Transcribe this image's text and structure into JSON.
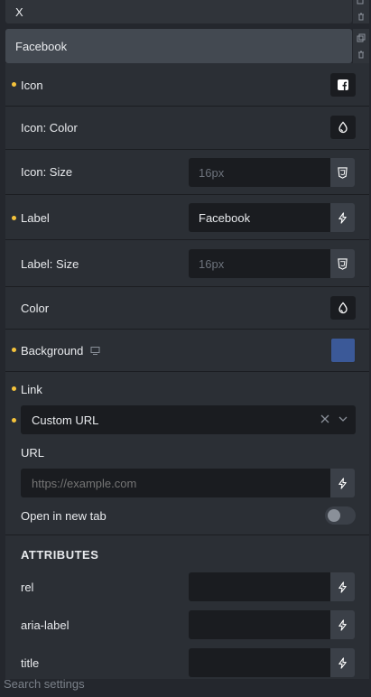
{
  "repeater": {
    "items": [
      {
        "label": "X"
      },
      {
        "label": "Facebook"
      }
    ]
  },
  "fields": {
    "icon": {
      "label": "Icon",
      "icon": "facebook-square-icon"
    },
    "icon_color": {
      "label": "Icon: Color",
      "icon": "color-drop-icon"
    },
    "icon_size": {
      "label": "Icon: Size",
      "placeholder": "16px",
      "suffix_icon": "css-shield-icon"
    },
    "label": {
      "label": "Label",
      "value": "Facebook",
      "suffix_icon": "bolt-icon"
    },
    "label_size": {
      "label": "Label: Size",
      "placeholder": "16px",
      "suffix_icon": "css-shield-icon"
    },
    "color": {
      "label": "Color",
      "icon": "color-drop-icon"
    },
    "background": {
      "label": "Background",
      "icon": "monitor-icon",
      "swatch_color": "#3b5998"
    },
    "link": {
      "label": "Link",
      "select_value": "Custom URL",
      "url_label": "URL",
      "url_placeholder": "https://example.com",
      "new_tab_label": "Open in new tab"
    }
  },
  "attributes": {
    "title": "ATTRIBUTES",
    "rows": [
      {
        "label": "rel"
      },
      {
        "label": "aria-label"
      },
      {
        "label": "title"
      }
    ]
  },
  "footer": {
    "search_placeholder": "Search settings"
  },
  "colors": {
    "accent_dot": "#f5c33b",
    "background_swatch": "#3b5998"
  }
}
